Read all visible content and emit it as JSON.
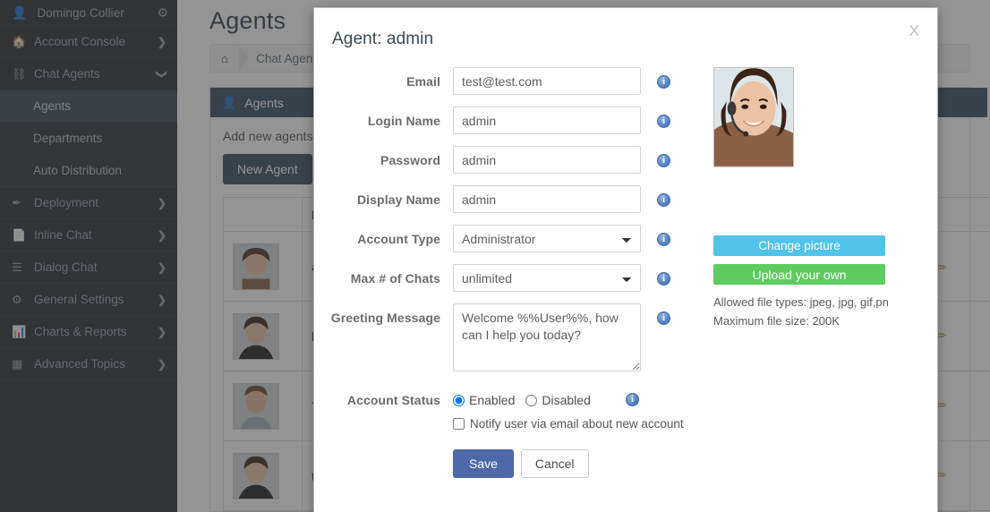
{
  "sidebar": {
    "user": {
      "name": "Domingo Collier",
      "icon": "user-icon",
      "gear": "⚙"
    },
    "items": [
      {
        "label": "Account Console",
        "icon": "🏠",
        "arrow": "❯",
        "expanded": false
      },
      {
        "label": "Chat Agents",
        "icon": "⛓",
        "arrow": "❯",
        "expanded": true
      },
      {
        "label": "Deployment",
        "icon": "✒",
        "arrow": "❯",
        "expanded": false
      },
      {
        "label": "Inline Chat",
        "icon": "📄",
        "arrow": "❯",
        "expanded": false
      },
      {
        "label": "Dialog Chat",
        "icon": "☰",
        "arrow": "❯",
        "expanded": false
      },
      {
        "label": "General Settings",
        "icon": "⚙",
        "arrow": "❯",
        "expanded": false
      },
      {
        "label": "Charts & Reports",
        "icon": "📊",
        "arrow": "❯",
        "expanded": false
      },
      {
        "label": "Advanced Topics",
        "icon": "▦",
        "arrow": "❯",
        "expanded": false
      }
    ],
    "subitems": [
      {
        "label": "Agents",
        "active": true
      },
      {
        "label": "Departments",
        "active": false
      },
      {
        "label": "Auto Distribution",
        "active": false
      }
    ]
  },
  "page": {
    "title": "Agents",
    "breadcrumb": {
      "home_icon": "⌂",
      "items": [
        "Chat Agents"
      ]
    },
    "panel": {
      "title": "Agents",
      "icon": "user-icon"
    },
    "description": "Add new agents, d",
    "new_agent_button": "New Agent",
    "table": {
      "columns": [
        "",
        "Log"
      ],
      "rows": [
        {
          "login": "adm",
          "avatar": "agent-photo-1",
          "edit_icon": "pencil-icon"
        },
        {
          "login": "ken",
          "avatar": "agent-photo-2",
          "edit_icon": "pencil-icon"
        },
        {
          "login": "Ter",
          "avatar": "agent-photo-3",
          "edit_icon": "pencil-icon"
        },
        {
          "login": "test",
          "avatar": "agent-photo-4",
          "edit_icon": "pencil-icon"
        }
      ]
    }
  },
  "modal": {
    "title": "Agent: admin",
    "close_label": "X",
    "fields": [
      {
        "label": "Email",
        "value": "test@test.com",
        "type": "text",
        "info": "i"
      },
      {
        "label": "Login Name",
        "value": "admin",
        "type": "text",
        "info": "i"
      },
      {
        "label": "Password",
        "value": "admin",
        "type": "text",
        "info": "i"
      },
      {
        "label": "Display Name",
        "value": "admin",
        "type": "text",
        "info": "i"
      },
      {
        "label": "Account Type",
        "value": "Administrator",
        "type": "select",
        "info": "i"
      },
      {
        "label": "Max # of Chats",
        "value": "unlimited",
        "type": "select",
        "info": "i"
      },
      {
        "label": "Greeting Message",
        "value": "Welcome %%User%%, how can I help you today?",
        "type": "textarea",
        "info": "i"
      }
    ],
    "account_status": {
      "label": "Account Status",
      "options": [
        {
          "label": "Enabled",
          "checked": true
        },
        {
          "label": "Disabled",
          "checked": false
        }
      ],
      "info": "i",
      "notify": {
        "label": "Notify user via email about new account",
        "checked": false
      }
    },
    "buttons": {
      "save": "Save",
      "cancel": "Cancel"
    },
    "picture": {
      "avatar": "agent-avatar-photo",
      "change_label": "Change picture",
      "upload_label": "Upload your own",
      "allowed_types": "Allowed file types: jpeg, jpg, gif,png",
      "max_size": "Maximum file size: 200K",
      "change_color": "#4fc3e8",
      "upload_color": "#5ecb5e"
    }
  },
  "colors": {
    "sidebar_bg": "#272c33",
    "panel_header": "#34495e",
    "save_button": "#4e69a8",
    "info_icon": "#4f7bc0"
  }
}
